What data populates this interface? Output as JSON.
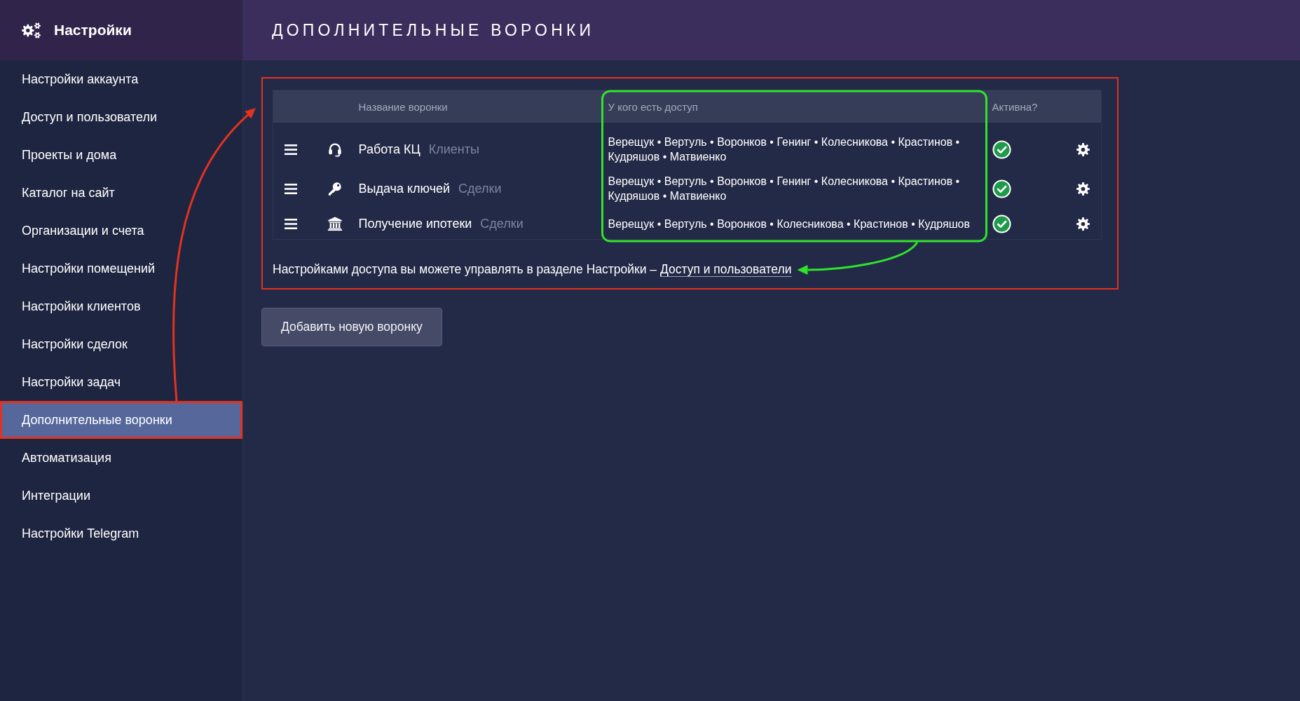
{
  "sidebar": {
    "title": "Настройки",
    "items": [
      {
        "label": "Настройки аккаунта",
        "selected": false
      },
      {
        "label": "Доступ и пользователи",
        "selected": false
      },
      {
        "label": "Проекты и дома",
        "selected": false
      },
      {
        "label": "Каталог на сайт",
        "selected": false
      },
      {
        "label": "Организации и счета",
        "selected": false
      },
      {
        "label": "Настройки помещений",
        "selected": false
      },
      {
        "label": "Настройки клиентов",
        "selected": false
      },
      {
        "label": "Настройки сделок",
        "selected": false
      },
      {
        "label": "Настройки задач",
        "selected": false
      },
      {
        "label": "Дополнительные воронки",
        "selected": true
      },
      {
        "label": "Автоматизация",
        "selected": false
      },
      {
        "label": "Интеграции",
        "selected": false
      },
      {
        "label": "Настройки Telegram",
        "selected": false
      }
    ]
  },
  "header": {
    "title": "ДОПОЛНИТЕЛЬНЫЕ ВОРОНКИ"
  },
  "table": {
    "columns": [
      "Название воронки",
      "У кого есть доступ",
      "Активна?"
    ],
    "rows": [
      {
        "kind": "call-center",
        "name": "Работа КЦ",
        "type": "Клиенты",
        "access": "Верещук • Вертуль • Воронков • Генинг • Колесникова • Крастинов • Кудряшов • Матвиенко",
        "active": true
      },
      {
        "kind": "key-handover",
        "name": "Выдача ключей",
        "type": "Сделки",
        "access": "Верещук • Вертуль • Воронков • Генинг • Колесникова • Крастинов • Кудряшов • Матвиенко",
        "active": true
      },
      {
        "kind": "mortgage",
        "name": "Получение ипотеки",
        "type": "Сделки",
        "access": "Верещук • Вертуль • Воронков • Колесникова • Крастинов • Кудряшов",
        "active": true
      }
    ]
  },
  "hint": {
    "text": "Настройками доступа вы можете управлять в разделе Настройки – ",
    "link": "Доступ и пользователи"
  },
  "add_button": {
    "label": "Добавить новую воронку"
  }
}
